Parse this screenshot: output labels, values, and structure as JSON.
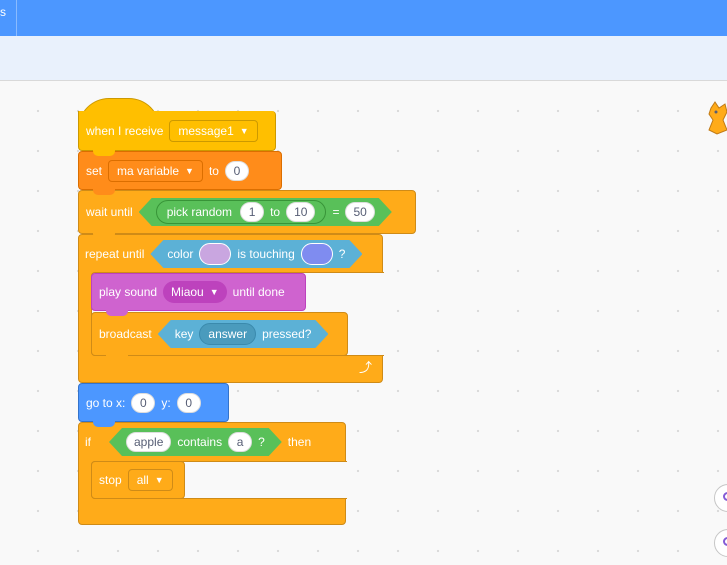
{
  "topbar": {
    "menu_fragment": "s"
  },
  "blocks": {
    "when_receive": {
      "label": "when I receive",
      "message": "message1"
    },
    "set_var": {
      "label": "set",
      "variable": "ma variable",
      "to_label": "to",
      "value": "0"
    },
    "wait_until": {
      "label": "wait until",
      "pick_label": "pick random",
      "from": "1",
      "to_label": "to",
      "to": "10",
      "eq": "=",
      "compare": "50"
    },
    "repeat_until": {
      "label": "repeat until",
      "color_label": "color",
      "touching_label": "is touching",
      "question": "?"
    },
    "play_sound": {
      "label": "play sound",
      "sound": "Miaou",
      "until_label": "until done"
    },
    "broadcast": {
      "label": "broadcast",
      "key_label": "key",
      "key": "answer",
      "pressed_label": "pressed?"
    },
    "go_to": {
      "label": "go to x:",
      "x": "0",
      "y_label": "y:",
      "y": "0"
    },
    "if_block": {
      "label": "if",
      "text": "apple",
      "contains_label": "contains",
      "needle": "a",
      "question": "?",
      "then_label": "then"
    },
    "stop": {
      "label": "stop",
      "option": "all"
    }
  },
  "colors": {
    "events": "#ffbf00",
    "data": "#ff8c1a",
    "control": "#ffab19",
    "motion": "#4c97ff",
    "sound": "#cf63cf",
    "operators": "#59c059",
    "sensing": "#5cb1d6",
    "swatch_1": "#c9a6e0",
    "swatch_2": "#7f8cf0"
  },
  "icons": {
    "dropdown_caret": "heart-caret-icon",
    "loop": "loop-arrow-icon",
    "sprite": "cat-sprite-icon"
  }
}
